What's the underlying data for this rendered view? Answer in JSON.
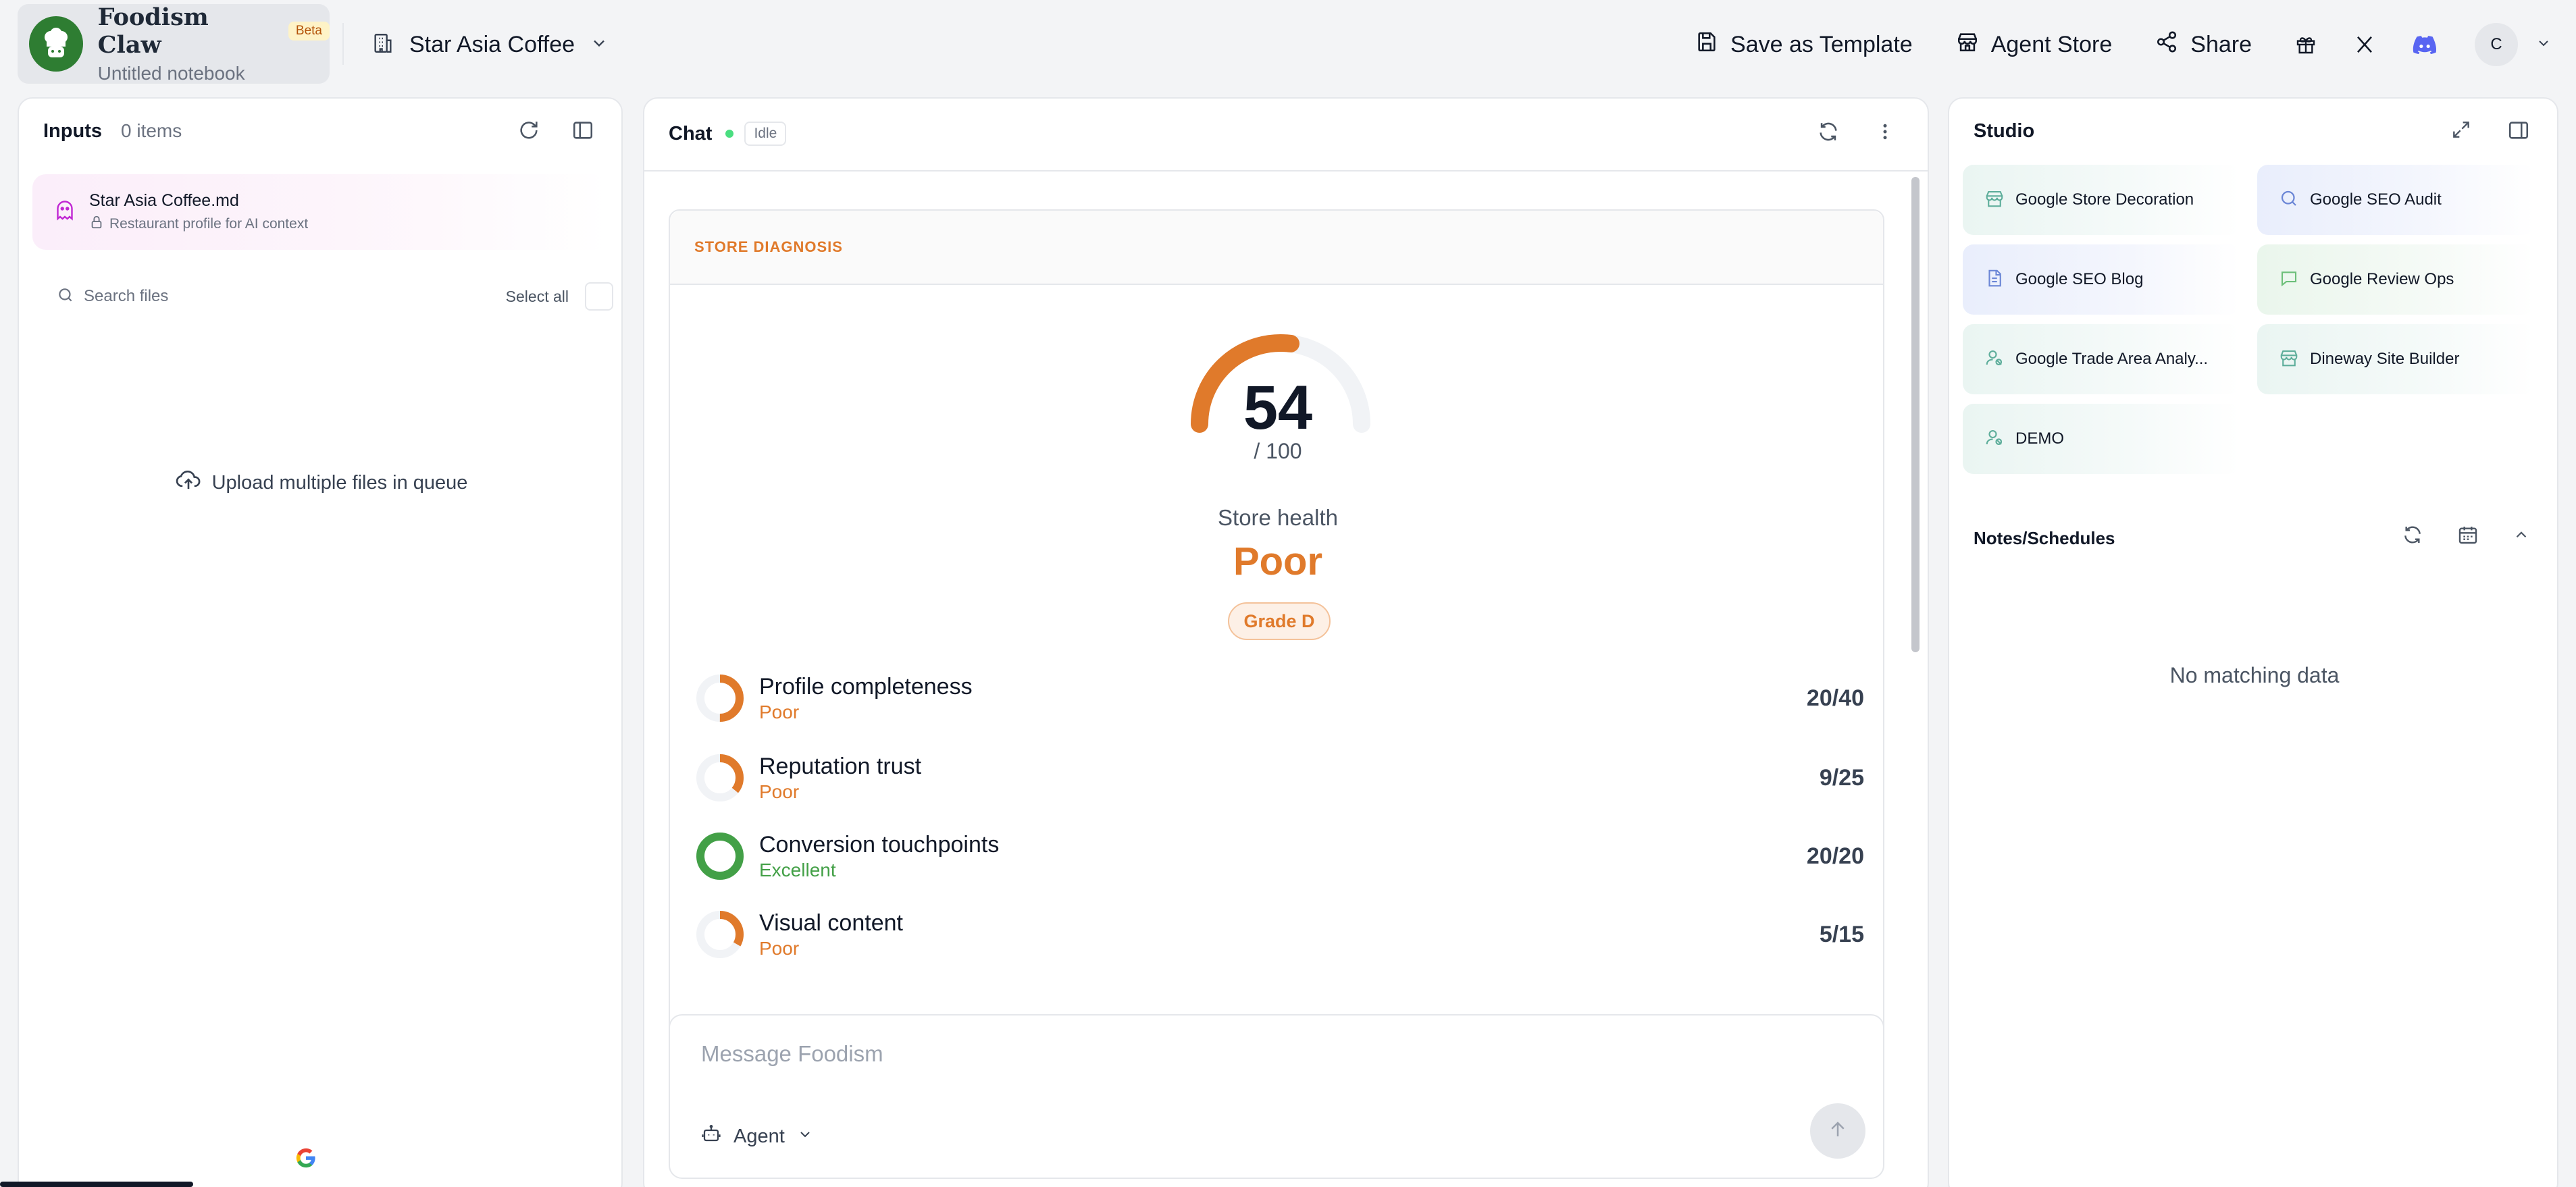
{
  "brand": {
    "name": "Foodism Claw",
    "badge": "Beta",
    "notebook": "Untitled notebook"
  },
  "store": {
    "name": "Star Asia Coffee"
  },
  "top_actions": {
    "save_template": "Save as Template",
    "agent_store": "Agent Store",
    "share": "Share"
  },
  "user": {
    "initial": "C"
  },
  "inputs": {
    "title": "Inputs",
    "count": "0 items",
    "file": {
      "name": "Star Asia Coffee.md",
      "desc": "Restaurant profile for AI context"
    },
    "search_placeholder": "Search files",
    "select_all": "Select all",
    "upload": "Upload multiple files in queue"
  },
  "chat": {
    "title": "Chat",
    "status": "Idle",
    "card": {
      "label": "STORE DIAGNOSIS",
      "score": "54",
      "score_value": 54,
      "score_max": "/ 100",
      "health_label": "Store health",
      "health_value": "Poor",
      "grade": "Grade D",
      "metrics": [
        {
          "name": "Profile completeness",
          "status": "Poor",
          "score": "20/40",
          "fraction": 0.5
        },
        {
          "name": "Reputation trust",
          "status": "Poor",
          "score": "9/25",
          "fraction": 0.36
        },
        {
          "name": "Conversion touchpoints",
          "status": "Excellent",
          "score": "20/20",
          "fraction": 1.0
        },
        {
          "name": "Visual content",
          "status": "Poor",
          "score": "5/15",
          "fraction": 0.333
        }
      ]
    },
    "composer": {
      "placeholder": "Message Foodism",
      "mode": "Agent"
    }
  },
  "studio": {
    "title": "Studio",
    "tiles": [
      {
        "label": "Google Store Decoration",
        "icon": "store-icon"
      },
      {
        "label": "Google SEO Audit",
        "icon": "search-icon"
      },
      {
        "label": "Google SEO Blog",
        "icon": "document-icon"
      },
      {
        "label": "Google Review Ops",
        "icon": "comment-icon"
      },
      {
        "label": "Google Trade Area Analy...",
        "icon": "person-icon"
      },
      {
        "label": "Dineway Site Builder",
        "icon": "store-icon"
      },
      {
        "label": "DEMO",
        "icon": "person-icon"
      }
    ],
    "notes_title": "Notes/Schedules",
    "empty": "No matching data"
  },
  "colors": {
    "accent": "#e07a2b",
    "good": "#43a047",
    "brand": "#2e7d32"
  }
}
